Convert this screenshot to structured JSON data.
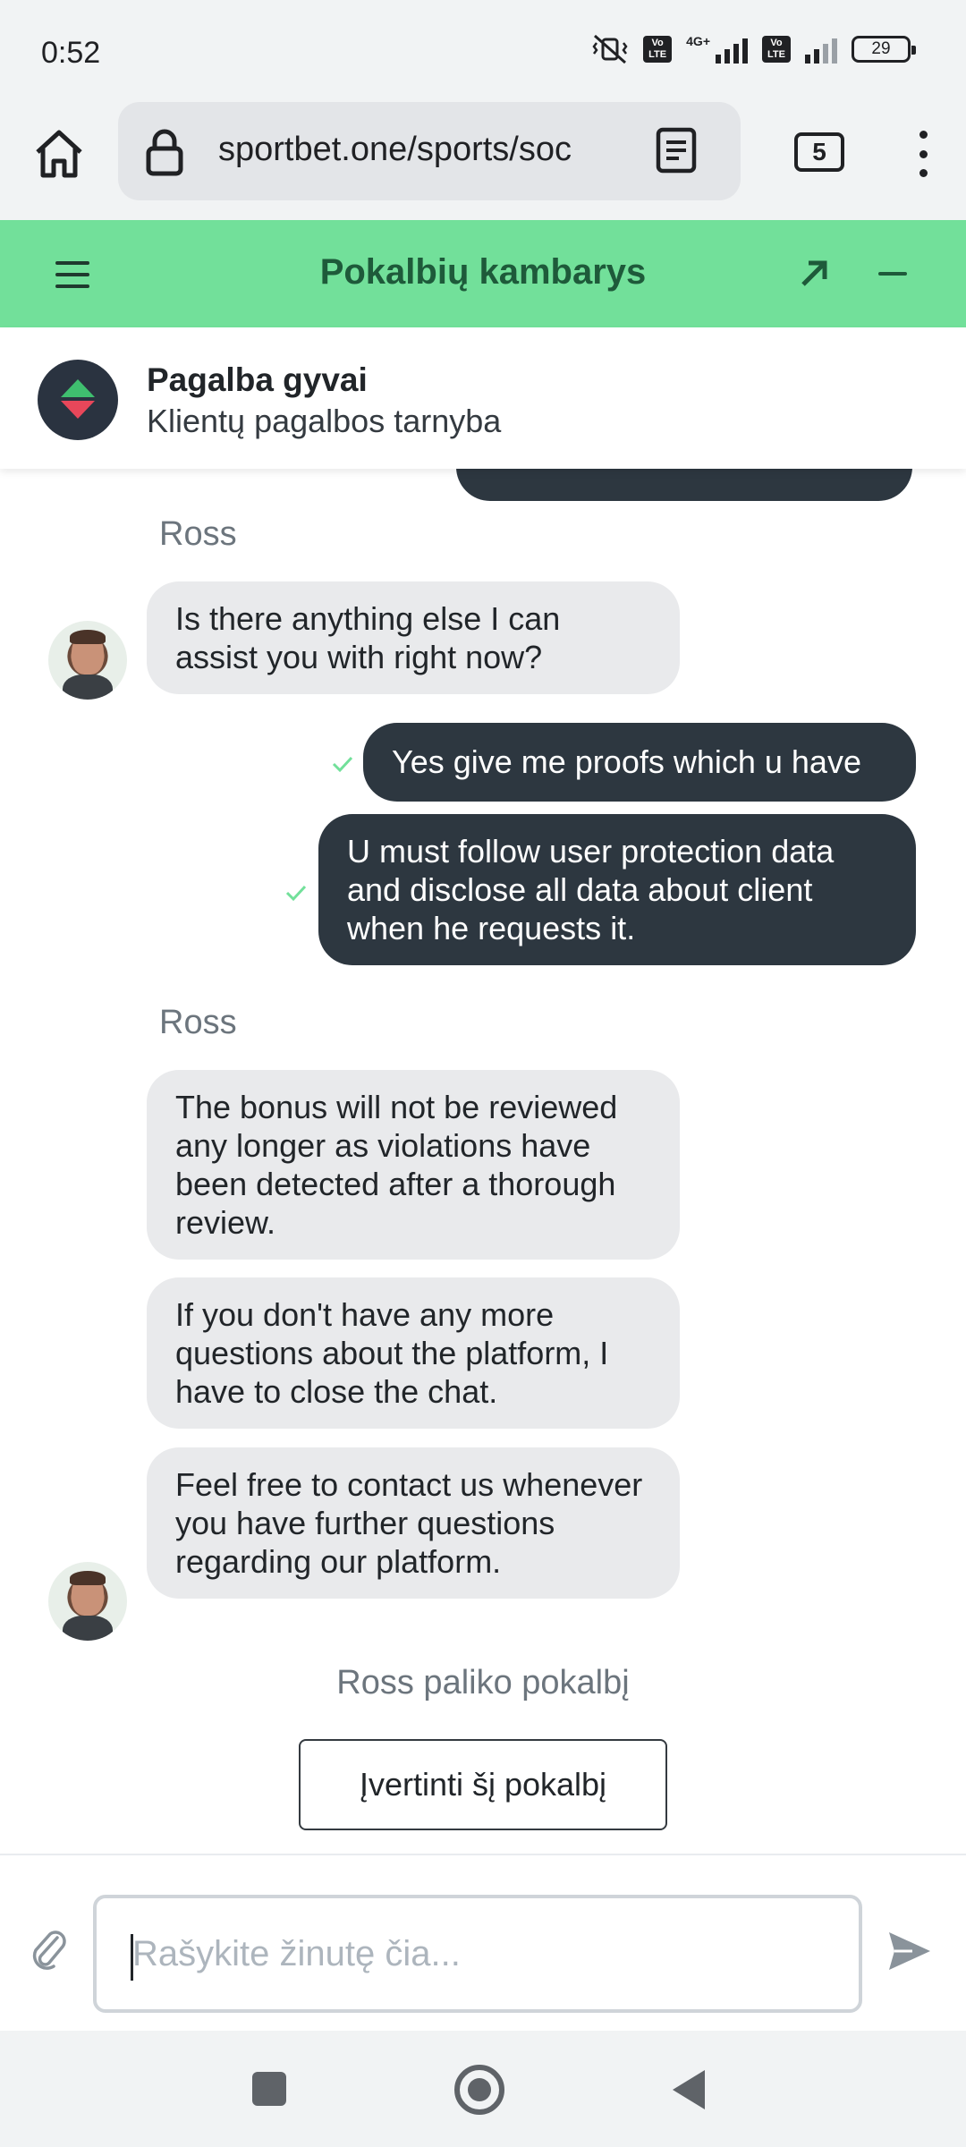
{
  "status_bar": {
    "time": "0:52",
    "network": "4G+",
    "volte": "Vo LTE",
    "battery": "29"
  },
  "browser": {
    "url": "sportbet.one/sports/soc",
    "tab_count": "5",
    "icons": [
      "home-icon",
      "lock-icon",
      "reader-mode-icon",
      "tabs-icon",
      "more-icon"
    ]
  },
  "chat_header": {
    "title": "Pokalbių kambarys"
  },
  "agent": {
    "name": "Pagalba gyvai",
    "role": "Klientų pagalbos tarnyba"
  },
  "messages": {
    "group1": {
      "sender": "Ross",
      "bubble1": "Is there anything else I can assist you with right now?"
    },
    "user": {
      "bubble1": "Yes give me proofs which u have",
      "bubble2": "U must follow user protection data and disclose all data about client when he requests it."
    },
    "group2": {
      "sender": "Ross",
      "bubble1": "The bonus will not be reviewed any longer as violations have been detected after a thorough review.",
      "bubble2": "If you don't have any more questions about the platform, I have to close the chat.",
      "bubble3": "Feel free to contact us whenever you have further questions regarding our platform."
    },
    "system": "Ross paliko pokalbį"
  },
  "rate_button": {
    "label": "Įvertinti šį pokalbį"
  },
  "composer": {
    "placeholder": "Rašykite žinutę čia...",
    "value": ""
  },
  "colors": {
    "header_bg": "#72e09a",
    "header_text": "#1e5a3a",
    "outgoing_bubble": "#2d3740",
    "incoming_bubble": "#e9eaec",
    "check_color": "#72e09a"
  }
}
